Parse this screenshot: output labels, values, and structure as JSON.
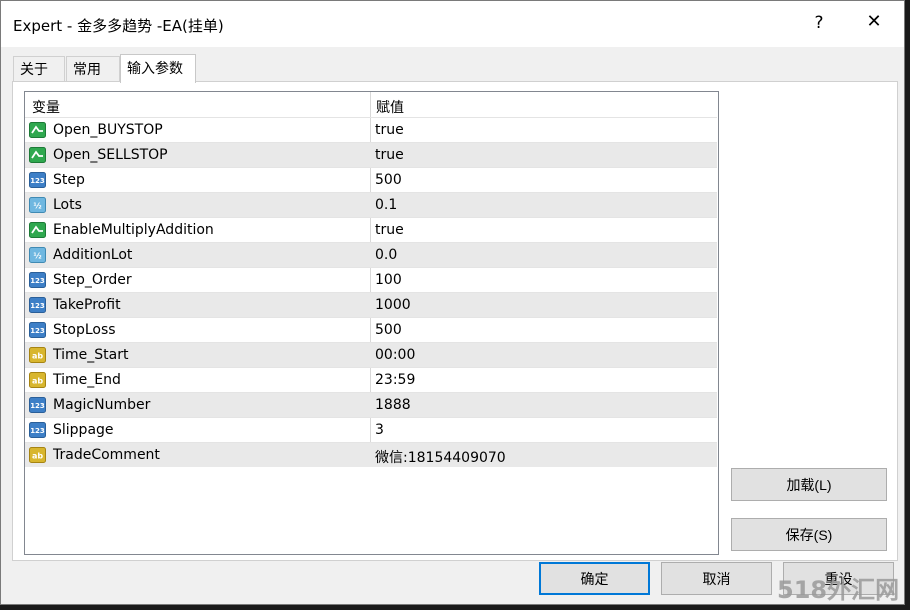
{
  "window": {
    "title": "Expert - 金多多趋势 -EA(挂单)",
    "help": "?",
    "close": "✕"
  },
  "tabs": [
    {
      "label": "关于",
      "active": false
    },
    {
      "label": "常用",
      "active": false
    },
    {
      "label": "输入参数",
      "active": true
    }
  ],
  "table": {
    "headers": {
      "variable": "变量",
      "value": "赋值"
    },
    "rows": [
      {
        "name": "Open_BUYSTOP",
        "value": "true",
        "type": "bool"
      },
      {
        "name": "Open_SELLSTOP",
        "value": "true",
        "type": "bool"
      },
      {
        "name": "Step",
        "value": "500",
        "type": "int"
      },
      {
        "name": "Lots",
        "value": "0.1",
        "type": "double"
      },
      {
        "name": "EnableMultiplyAddition",
        "value": "true",
        "type": "bool"
      },
      {
        "name": "AdditionLot",
        "value": "0.0",
        "type": "double"
      },
      {
        "name": "Step_Order",
        "value": "100",
        "type": "int"
      },
      {
        "name": "TakeProfit",
        "value": "1000",
        "type": "int"
      },
      {
        "name": "StopLoss",
        "value": "500",
        "type": "int"
      },
      {
        "name": "Time_Start",
        "value": "00:00",
        "type": "string"
      },
      {
        "name": "Time_End",
        "value": "23:59",
        "type": "string"
      },
      {
        "name": "MagicNumber",
        "value": "1888",
        "type": "int"
      },
      {
        "name": "Slippage",
        "value": "3",
        "type": "int"
      },
      {
        "name": "TradeComment",
        "value": "微信:18154409070",
        "type": "string"
      }
    ]
  },
  "buttons": {
    "load": "加载(L)",
    "save": "保存(S)",
    "ok": "确定",
    "cancel": "取消",
    "reset": "重设"
  },
  "watermark": "518外汇网",
  "colors": {
    "accent": "#0078d7",
    "bool_icon": "#2fa84f",
    "int_icon": "#3d7fc7",
    "double_icon": "#6fb7e0",
    "string_icon": "#d8b62e"
  }
}
